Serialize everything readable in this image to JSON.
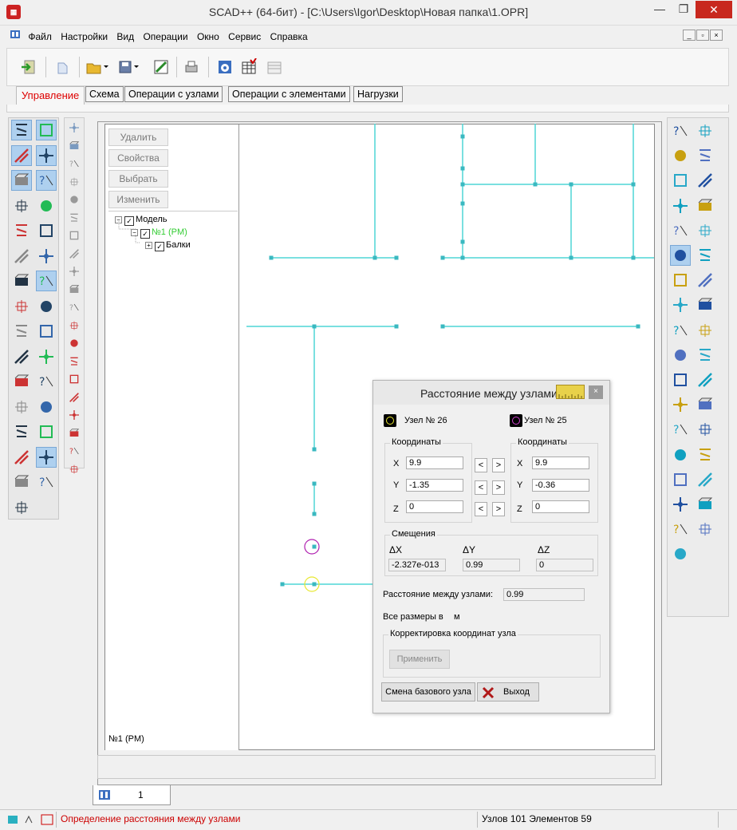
{
  "window": {
    "title": "SCAD++ (64-бит) - [C:\\Users\\Igor\\Desktop\\Новая папка\\1.OPR]",
    "minimize": "—",
    "restore": "❐",
    "close": "✕"
  },
  "menu": {
    "items": [
      "Файл",
      "Настройки",
      "Вид",
      "Операции",
      "Окно",
      "Сервис",
      "Справка"
    ],
    "mdi": [
      "_",
      "▫",
      "×"
    ]
  },
  "tabs": {
    "items": [
      "Управление",
      "Схема",
      "Операции с узлами",
      "Операции с элементами",
      "Нагрузки"
    ]
  },
  "panel": {
    "buttons": [
      "Удалить",
      "Свойства",
      "Выбрать",
      "Изменить"
    ],
    "tree": {
      "root": "Модель",
      "child": "№1 (PM)",
      "leaf": "Балки"
    },
    "footer": "№1 (PM)"
  },
  "doc_tab": {
    "label": "1"
  },
  "status": {
    "message": "Определение расстояния между узлами",
    "counts": "Узлов 101 Элементов 59"
  },
  "dialog": {
    "title": "Расстояние между узлами",
    "node1_label": "Узел №",
    "node1_num": "26",
    "node2_label": "Узел №",
    "node2_num": "25",
    "coords_title": "Координаты",
    "x_label": "X",
    "y_label": "Y",
    "z_label": "Z",
    "node1": {
      "x": "9.9",
      "y": "-1.35",
      "z": "0"
    },
    "node2": {
      "x": "9.9",
      "y": "-0.36",
      "z": "0"
    },
    "arrow_left": "<",
    "arrow_right": ">",
    "offsets_title": "Смещения",
    "dx_label": "ΔX",
    "dy_label": "ΔY",
    "dz_label": "ΔZ",
    "dx": "-2.327e-013",
    "dy": "0.99",
    "dz": "0",
    "distance_label": "Расстояние между узлами:",
    "distance": "0.99",
    "units_label": "Все размеры в",
    "units": "м",
    "correction_title": "Корректировка координат узла",
    "apply_button": "Применить",
    "change_base_button": "Смена базового узла",
    "exit_button": "Выход"
  },
  "colors": {
    "accent_red": "#cc0000",
    "model_lines": "#4fd6d6",
    "node_marker": "#3ab8c0",
    "node26_circle": "#e8e830",
    "node25_circle": "#b020b0",
    "tree_highlight": "#33cc33",
    "selected_tool": "#aed0ef"
  }
}
